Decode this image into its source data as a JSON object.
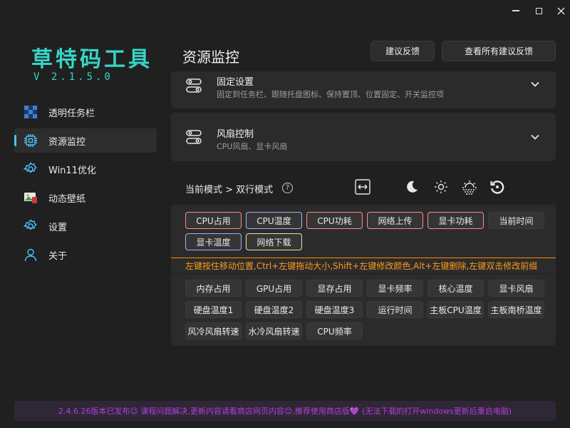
{
  "app": {
    "title": "草特码工具",
    "version": "V 2.1.5.0"
  },
  "nav": {
    "items": [
      {
        "label": "透明任务栏"
      },
      {
        "label": "资源监控"
      },
      {
        "label": "Win11优化"
      },
      {
        "label": "动态壁纸"
      },
      {
        "label": "设置"
      },
      {
        "label": "关于"
      }
    ]
  },
  "header": {
    "title": "资源监控",
    "feedback_label": "建议反馈",
    "view_feedback_label": "查看所有建议反馈"
  },
  "cards": {
    "fixed": {
      "title": "固定设置",
      "subtitle": "固定到任务栏、跟随托盘图标、保持置顶、位置固定、开关监控项"
    },
    "fan": {
      "title": "风扇控制",
      "subtitle": "CPU风扇、显卡风扇"
    }
  },
  "mode": {
    "label": "当前模式 > 双行模式",
    "help": "?"
  },
  "active_items": [
    {
      "label": "CPU占用"
    },
    {
      "label": "CPU温度"
    },
    {
      "label": "CPU功耗"
    },
    {
      "label": "网络上传"
    },
    {
      "label": "显卡功耗"
    },
    {
      "label": "当前时间"
    },
    {
      "label": "显卡温度"
    },
    {
      "label": "网络下载"
    }
  ],
  "hint": "左键按住移动位置,Ctrl+左键拖动大小,Shift+左键修改颜色,Alt+左键删除,左键双击修改前缀",
  "available_items": [
    {
      "label": "内存占用"
    },
    {
      "label": "GPU占用"
    },
    {
      "label": "显存占用"
    },
    {
      "label": "显卡频率"
    },
    {
      "label": "核心温度"
    },
    {
      "label": "显卡风扇"
    },
    {
      "label": "硬盘温度1"
    },
    {
      "label": "硬盘温度2"
    },
    {
      "label": "硬盘温度3"
    },
    {
      "label": "运行时间"
    },
    {
      "label": "主板CPU温度"
    },
    {
      "label": "主板南桥温度"
    },
    {
      "label": "风冷风扇转速"
    },
    {
      "label": "水冷风扇转速"
    },
    {
      "label": "CPU频率"
    }
  ],
  "notice": "2.4.6.26版本已发布😊 课程问题解决,更新内容请看商店网页内容😊,推荐使用商店版💜 (无法下载的打开windows更新后重启电脑)",
  "colors": {
    "accent": "#36d6c6",
    "nav_indicator": "#4cc2ff",
    "hint": "#ff9a1a",
    "notice": "#b13fd8"
  }
}
